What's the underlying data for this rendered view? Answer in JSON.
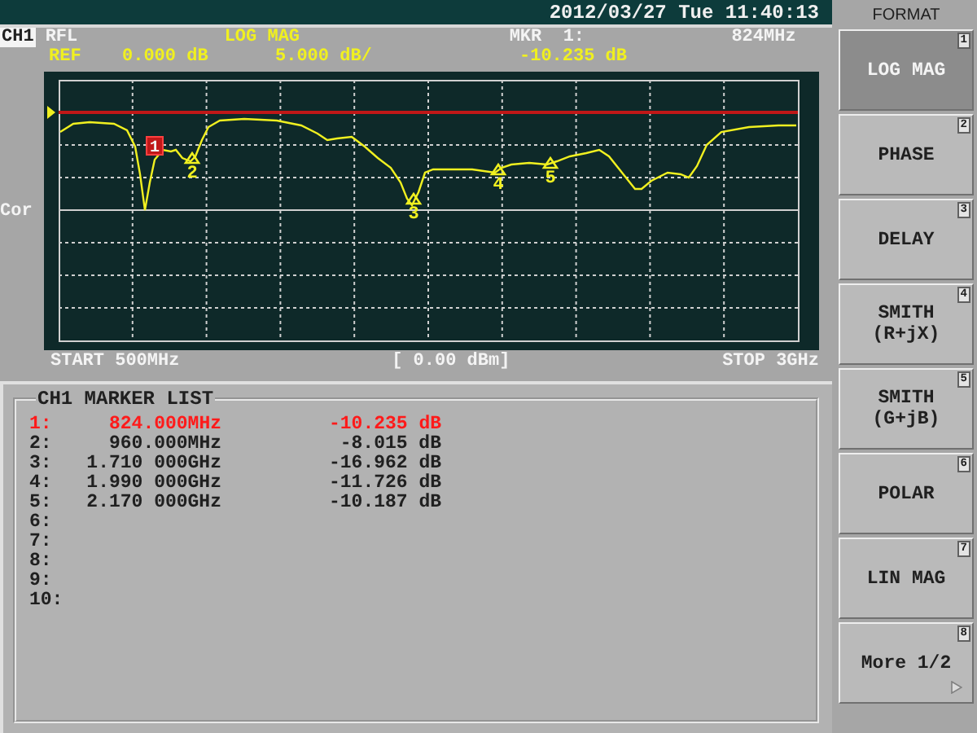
{
  "header": {
    "channel": "CH1",
    "measurement": "RFL",
    "format": "LOG MAG",
    "marker_label": "MKR  1:",
    "marker_freq": "824MHz",
    "datetime": "2012/03/27 Tue 11:40:13"
  },
  "scale": {
    "ref": "REF",
    "ref_value": "0.000 dB",
    "per_div": "5.000 dB/",
    "marker_value": "-10.235 dB"
  },
  "plot": {
    "side_label": "Cor",
    "markers": [
      {
        "label": "1",
        "selected": true
      },
      {
        "label": "2",
        "selected": false
      },
      {
        "label": "3",
        "selected": false
      },
      {
        "label": "4",
        "selected": false
      },
      {
        "label": "5",
        "selected": false
      }
    ],
    "start": "START 500MHz",
    "power": "[ 0.00 dBm]",
    "stop": "STOP 3GHz"
  },
  "marker_list": {
    "title": "CH1 MARKER LIST",
    "rows": [
      {
        "index": "1:",
        "frequency": "824.000MHz",
        "value": "-10.235 dB",
        "selected": true
      },
      {
        "index": "2:",
        "frequency": "960.000MHz",
        "value": "-8.015 dB",
        "selected": false
      },
      {
        "index": "3:",
        "frequency": "1.710 000GHz",
        "value": "-16.962 dB",
        "selected": false
      },
      {
        "index": "4:",
        "frequency": "1.990 000GHz",
        "value": "-11.726 dB",
        "selected": false
      },
      {
        "index": "5:",
        "frequency": "2.170 000GHz",
        "value": "-10.187 dB",
        "selected": false
      },
      {
        "index": "6:",
        "selected": false
      },
      {
        "index": "7:",
        "selected": false
      },
      {
        "index": "8:",
        "selected": false
      },
      {
        "index": "9:",
        "selected": false
      },
      {
        "index": "10:",
        "selected": false
      }
    ]
  },
  "menu": {
    "title": "FORMAT",
    "keys": [
      {
        "label": "LOG MAG",
        "number": "1",
        "selected": true,
        "kind": "plain"
      },
      {
        "label": "PHASE",
        "number": "2",
        "selected": false,
        "kind": "plain"
      },
      {
        "label": "DELAY",
        "number": "3",
        "selected": false,
        "kind": "plain"
      },
      {
        "label": "SMITH\n(R+jX)",
        "number": "4",
        "selected": false,
        "kind": "plain"
      },
      {
        "label": "SMITH\n(G+jB)",
        "number": "5",
        "selected": false,
        "kind": "plain"
      },
      {
        "label": "POLAR",
        "number": "6",
        "selected": false,
        "kind": "plain"
      },
      {
        "label": "LIN MAG",
        "number": "7",
        "selected": false,
        "kind": "plain"
      },
      {
        "label": "More 1/2",
        "number": "8",
        "selected": false,
        "kind": "more"
      }
    ]
  }
}
